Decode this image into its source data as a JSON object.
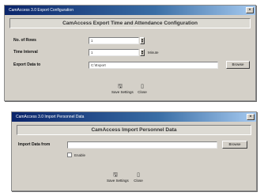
{
  "dialog1": {
    "title": "CamAccess 3.0 Export Configuration",
    "banner": "CamAccess Export Time and Attendance Configuration",
    "rows_label": "No. of Rows",
    "rows_value": "1",
    "interval_label": "Time Interval",
    "interval_value": "1",
    "interval_unit": "Minute",
    "export_label": "Export Data to",
    "export_value": "C:\\Export",
    "browse_label": "Browse",
    "save_label": "Save Settings",
    "close_label": "Close"
  },
  "dialog2": {
    "title": "CamAccess 3.0 Import Personnel Data",
    "banner": "CamAccess Import Personnel Data",
    "import_label": "Import Data from",
    "import_value": "",
    "browse_label": "Browse",
    "enable_label": "Enable",
    "save_label": "Save Settings",
    "close_label": "Close"
  },
  "colors": {
    "titlebar_start": "#0a246a",
    "titlebar_end": "#a6caf0",
    "dialog_face": "#d4d0c8"
  },
  "icons": [
    "close-icon",
    "save-icon",
    "door-exit-icon",
    "spin-arrows-icon"
  ]
}
